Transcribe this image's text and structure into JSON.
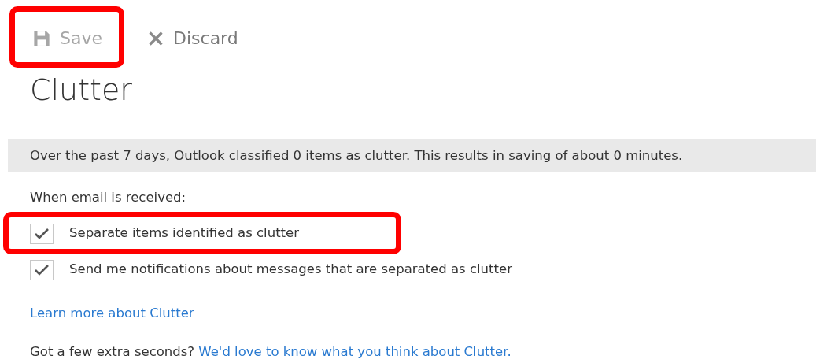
{
  "toolbar": [
    {
      "kind": "save",
      "label": "Save",
      "disabled": true
    },
    {
      "kind": "discard",
      "label": "Discard",
      "disabled": false
    }
  ],
  "title": "Clutter",
  "summary": "Over the past 7 days, Outlook classified 0 items as clutter. This results in saving of about 0 minutes.",
  "options_label": "When email is received:",
  "options": [
    {
      "label": "Separate items identified as clutter",
      "checked": true,
      "highlighted": true
    },
    {
      "label": "Send me notifications about messages that are separated as clutter",
      "checked": true,
      "highlighted": false
    }
  ],
  "learn_more_link": "Learn more about Clutter",
  "feedback": {
    "text": "Got a few extra seconds?",
    "link": "We'd love to know what you think about Clutter."
  },
  "highlight_save": true
}
